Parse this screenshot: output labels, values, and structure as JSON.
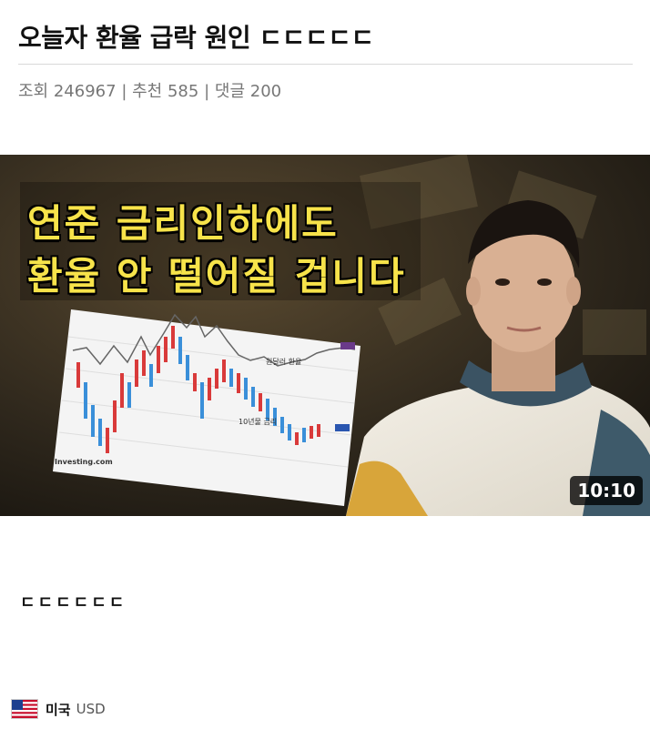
{
  "post": {
    "title": "오늘자 환율 급락 원인 ㄷㄷㄷㄷㄷ",
    "meta": {
      "views_label": "조회",
      "views": "246967",
      "recommend_label": "추천",
      "recommend": "585",
      "comments_label": "댓글",
      "comments": "200",
      "separator": "|"
    },
    "body_text": "ㄷㄷㄷㄷㄷㄷ"
  },
  "video": {
    "caption_line1": "연준 금리인하에도",
    "caption_line2": "환율 안 떨어질 겁니다",
    "duration": "10:10",
    "chart": {
      "label_top": "원달러 환율",
      "label_bottom": "10년물 금리",
      "watermark": "Investing.com"
    }
  },
  "currency": {
    "country": "미국",
    "code": "USD",
    "flag_icon": "us-flag-icon"
  },
  "colors": {
    "caption_yellow": "#f7e34a",
    "bull_candle": "#d93a3a",
    "bear_candle": "#3a8fd9"
  }
}
